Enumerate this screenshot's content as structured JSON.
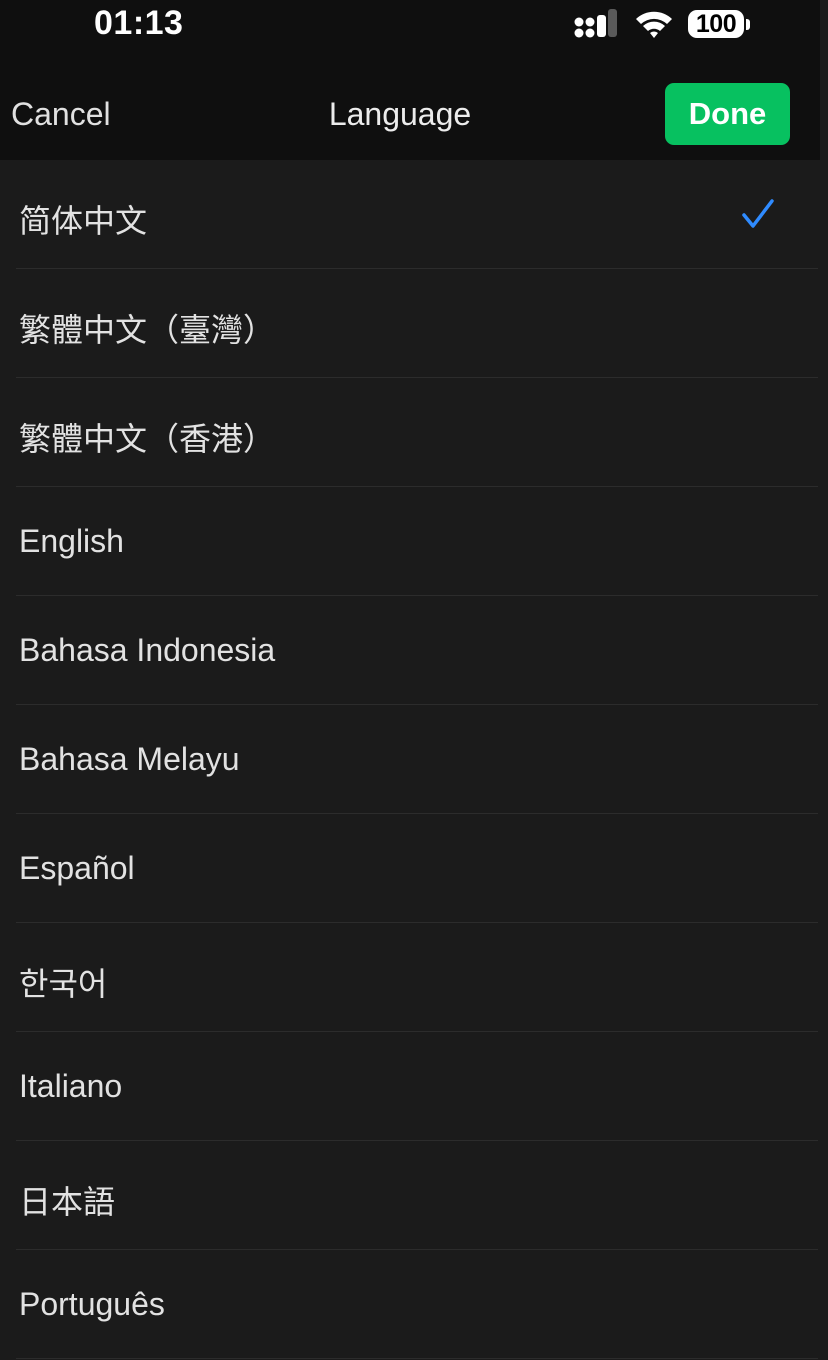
{
  "status_bar": {
    "time": "01:13",
    "signal_icon": "cellular-signal-icon",
    "wifi_icon": "wifi-icon",
    "battery": "100"
  },
  "nav": {
    "cancel_label": "Cancel",
    "title": "Language",
    "done_label": "Done",
    "done_color": "#07c160"
  },
  "check_color": "#2f8bff",
  "languages": [
    {
      "label": "简体中文",
      "selected": true
    },
    {
      "label": "繁體中文（臺灣）",
      "selected": false
    },
    {
      "label": "繁體中文（香港）",
      "selected": false
    },
    {
      "label": "English",
      "selected": false
    },
    {
      "label": "Bahasa Indonesia",
      "selected": false
    },
    {
      "label": "Bahasa Melayu",
      "selected": false
    },
    {
      "label": "Español",
      "selected": false
    },
    {
      "label": "한국어",
      "selected": false
    },
    {
      "label": "Italiano",
      "selected": false
    },
    {
      "label": "日本語",
      "selected": false
    },
    {
      "label": "Português",
      "selected": false
    }
  ]
}
